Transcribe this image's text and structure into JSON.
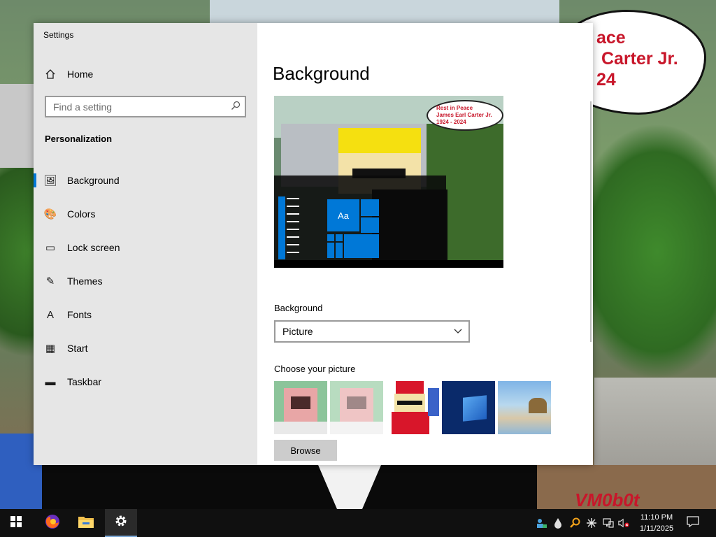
{
  "window": {
    "title": "Settings",
    "minimize_glyph": "—",
    "maximize_glyph": "☐",
    "close_glyph": "✕"
  },
  "sidebar": {
    "home_label": "Home",
    "search_placeholder": "Find a setting",
    "section_title": "Personalization",
    "items": [
      {
        "label": "Background",
        "icon": "picture-icon",
        "glyph": "🖼",
        "active": true
      },
      {
        "label": "Colors",
        "icon": "palette-icon",
        "glyph": "🎨",
        "active": false
      },
      {
        "label": "Lock screen",
        "icon": "lock-screen-icon",
        "glyph": "▭",
        "active": false
      },
      {
        "label": "Themes",
        "icon": "themes-icon",
        "glyph": "✎",
        "active": false
      },
      {
        "label": "Fonts",
        "icon": "fonts-icon",
        "glyph": "A",
        "active": false
      },
      {
        "label": "Start",
        "icon": "start-icon",
        "glyph": "▦",
        "active": false
      },
      {
        "label": "Taskbar",
        "icon": "taskbar-icon",
        "glyph": "▬",
        "active": false
      }
    ]
  },
  "content": {
    "page_title": "Background",
    "preview": {
      "tile_label": "Aa",
      "bubble_text": "Rest in Peace\nJames Earl Carter Jr.\n1924 - 2024"
    },
    "background_label": "Background",
    "background_value": "Picture",
    "choose_label": "Choose your picture",
    "browse_label": "Browse"
  },
  "desktop": {
    "bubble_text": "ace\n Carter Jr.\n24",
    "watermark": "VM0b0t"
  },
  "taskbar": {
    "time": "11:10 PM",
    "date": "1/11/2025"
  },
  "colors": {
    "accent": "#0078d7",
    "close_red": "#e81123"
  }
}
